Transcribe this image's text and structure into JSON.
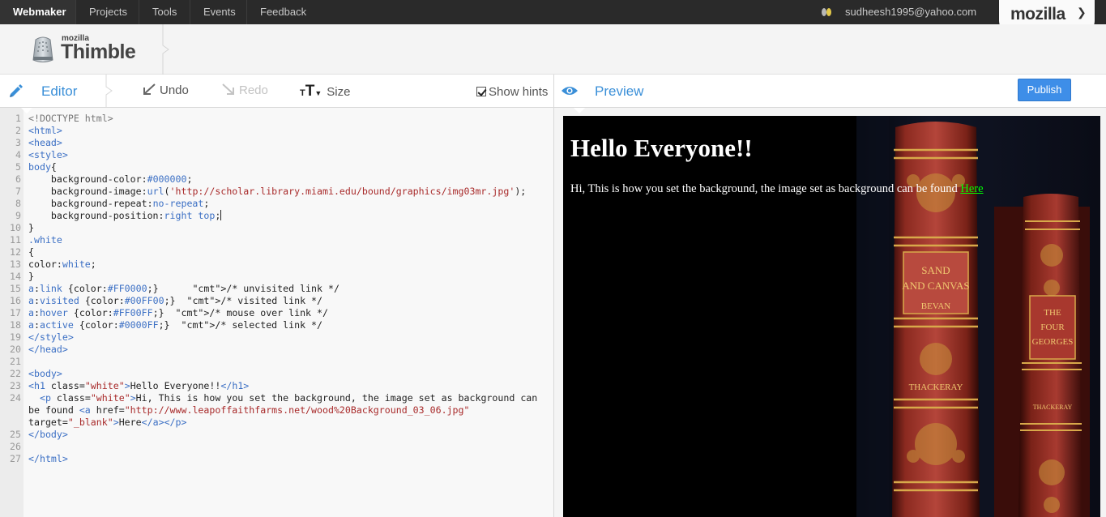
{
  "nav": {
    "items": [
      "Webmaker",
      "Projects",
      "Tools",
      "Events",
      "Feedback"
    ],
    "user_email": "sudheesh1995@yahoo.com",
    "brand": "mozilla"
  },
  "logo": {
    "small": "mozilla",
    "big": "Thimble"
  },
  "toolbar": {
    "editor_label": "Editor",
    "undo_label": "Undo",
    "redo_label": "Redo",
    "size_label": "Size",
    "hints_label": "Show hints",
    "hints_checked": true,
    "preview_label": "Preview",
    "publish_label": "Publish"
  },
  "editor": {
    "lines": [
      {
        "n": "1",
        "text": "<!DOCTYPE html>"
      },
      {
        "n": "2",
        "text": "<html>"
      },
      {
        "n": "3",
        "text": "<head>"
      },
      {
        "n": "4",
        "text": "<style>"
      },
      {
        "n": "5",
        "text": "body{"
      },
      {
        "n": "6",
        "text": "    background-color:#000000;"
      },
      {
        "n": "7",
        "text": "    background-image:url('http://scholar.library.miami.edu/bound/graphics/img03mr.jpg');"
      },
      {
        "n": "8",
        "text": "    background-repeat:no-repeat;"
      },
      {
        "n": "9",
        "text": "    background-position:right top;"
      },
      {
        "n": "10",
        "text": "}"
      },
      {
        "n": "11",
        "text": ".white"
      },
      {
        "n": "12",
        "text": "{"
      },
      {
        "n": "13",
        "text": "color:white;"
      },
      {
        "n": "14",
        "text": "}"
      },
      {
        "n": "15",
        "text": "a:link {color:#FF0000;}      /* unvisited link */"
      },
      {
        "n": "16",
        "text": "a:visited {color:#00FF00;}  /* visited link */"
      },
      {
        "n": "17",
        "text": "a:hover {color:#FF00FF;}  /* mouse over link */"
      },
      {
        "n": "18",
        "text": "a:active {color:#0000FF;}  /* selected link */"
      },
      {
        "n": "19",
        "text": "</style>"
      },
      {
        "n": "20",
        "text": "</head>"
      },
      {
        "n": "21",
        "text": ""
      },
      {
        "n": "22",
        "text": "<body>"
      },
      {
        "n": "23",
        "text": "<h1 class=\"white\">Hello Everyone!!</h1>"
      },
      {
        "n": "24",
        "text": "  <p class=\"white\">Hi, This is how you set the background, the image set as background can"
      },
      {
        "n": "",
        "text": "be found <a href=\"http://www.leapoffaithfarms.net/wood%20Background_03_06.jpg\""
      },
      {
        "n": "",
        "text": "target=\"_blank\">Here</a></p>"
      },
      {
        "n": "25",
        "text": "</body>"
      },
      {
        "n": "26",
        "text": ""
      },
      {
        "n": "27",
        "text": "</html>"
      }
    ]
  },
  "preview": {
    "heading": "Hello Everyone!!",
    "paragraph": "Hi, This is how you set the background, the image set as background can be found ",
    "link_text": "Here",
    "book_spine_1": [
      "SAND",
      "AND CANVAS",
      "BEVAN",
      "THACKERAY"
    ],
    "book_spine_2": [
      "THE",
      "FOUR",
      "GEORGES",
      "THACKERAY"
    ]
  },
  "colors": {
    "accent": "#3a8fd8",
    "publish": "#3e8ee8",
    "nav_bg": "#2a2a2a",
    "preview_bg": "#000000",
    "link_visited": "#00ff00"
  }
}
